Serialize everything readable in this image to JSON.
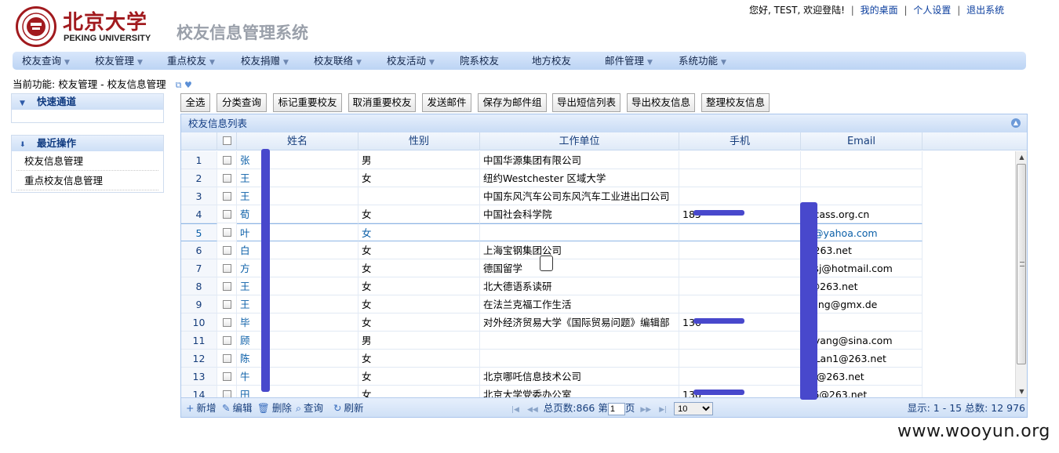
{
  "header": {
    "brand_cn": "北京大学",
    "brand_en": "PEKING UNIVERSITY",
    "system_title": "校友信息管理系统",
    "user_bar": {
      "greeting": "您好, TEST, 欢迎登陆!",
      "links": [
        "我的桌面",
        "个人设置",
        "退出系统"
      ]
    }
  },
  "nav": {
    "items": [
      {
        "label": "校友查询",
        "dropdown": true
      },
      {
        "label": "校友管理",
        "dropdown": true
      },
      {
        "label": "重点校友",
        "dropdown": true
      },
      {
        "label": "校友捐赠",
        "dropdown": true
      },
      {
        "label": "校友联络",
        "dropdown": true
      },
      {
        "label": "校友活动",
        "dropdown": true
      },
      {
        "label": "院系校友",
        "dropdown": false
      },
      {
        "label": "地方校友",
        "dropdown": false
      },
      {
        "label": "邮件管理",
        "dropdown": true
      },
      {
        "label": "系统功能",
        "dropdown": true
      }
    ]
  },
  "current_function": {
    "label": "当前功能:",
    "path": "校友管理 - 校友信息管理"
  },
  "sidebar": {
    "quick_access": {
      "title": "快速通道",
      "items": []
    },
    "recent_ops": {
      "title": "最近操作",
      "items": [
        "校友信息管理",
        "重点校友信息管理"
      ]
    }
  },
  "toolbar": {
    "buttons": [
      "全选",
      "分类查询",
      "标记重要校友",
      "取消重要校友",
      "发送邮件",
      "保存为邮件组",
      "导出短信列表",
      "导出校友信息",
      "整理校友信息"
    ]
  },
  "grid": {
    "title": "校友信息列表",
    "columns": [
      "姓名",
      "性别",
      "工作单位",
      "手机",
      "Email"
    ],
    "rows": [
      {
        "num": "1",
        "name": "张",
        "gender": "男",
        "company": "中国华源集团有限公司",
        "phone": "",
        "email": ""
      },
      {
        "num": "2",
        "name": "王",
        "gender": "女",
        "company": "纽约Westchester 区域大学",
        "phone": "",
        "email": ""
      },
      {
        "num": "3",
        "name": "王",
        "gender": "",
        "company": "中国东风汽车公司东风汽车工业进出口公司",
        "phone": "",
        "email": ""
      },
      {
        "num": "4",
        "name": "荀",
        "gender": "女",
        "company": "中国社会科学院",
        "phone": "185",
        "email": "@cass.org.cn"
      },
      {
        "num": "5",
        "name": "叶",
        "gender": "女",
        "company": "",
        "phone": "",
        "email": "af@yahoa.com"
      },
      {
        "num": "6",
        "name": "白",
        "gender": "女",
        "company": "上海宝钢集团公司",
        "phone": "",
        "email": "@263.net"
      },
      {
        "num": "7",
        "name": "方",
        "gender": "女",
        "company": "德国留学",
        "phone": "",
        "email": "h-sj@hotmail.com"
      },
      {
        "num": "8",
        "name": "王",
        "gender": "女",
        "company": "北大德语系读研",
        "phone": "",
        "email": "a@263.net"
      },
      {
        "num": "9",
        "name": "王",
        "gender": "女",
        "company": "在法兰克福工作生活",
        "phone": "",
        "email": "wang@gmx.de"
      },
      {
        "num": "10",
        "name": "毕",
        "gender": "女",
        "company": "对外经济贸易大学《国际贸易问题》编辑部",
        "phone": "136",
        "email": ""
      },
      {
        "num": "11",
        "name": "顾",
        "gender": "男",
        "company": "",
        "phone": "",
        "email": "rgyang@sina.com"
      },
      {
        "num": "12",
        "name": "陈",
        "gender": "女",
        "company": "",
        "phone": "",
        "email": "YaLan1@263.net"
      },
      {
        "num": "13",
        "name": "牛",
        "gender": "女",
        "company": "北京哪吒信息技术公司",
        "phone": "",
        "email": "ng@263.net"
      },
      {
        "num": "14",
        "name": "田",
        "gender": "女",
        "company": "北京大学党委办公室",
        "phone": "136",
        "email": "l96@263.net"
      }
    ],
    "selected_row": 5,
    "footer": {
      "actions": [
        "新增",
        "编辑",
        "删除",
        "查询",
        "刷新"
      ],
      "total_pages_label": "总页数:866",
      "page_prefix": "第",
      "page_value": "1",
      "page_suffix": "页",
      "page_size": "10",
      "summary": "显示: 1 - 15 总数: 12 976"
    }
  },
  "watermark": "www.wooyun.org"
}
